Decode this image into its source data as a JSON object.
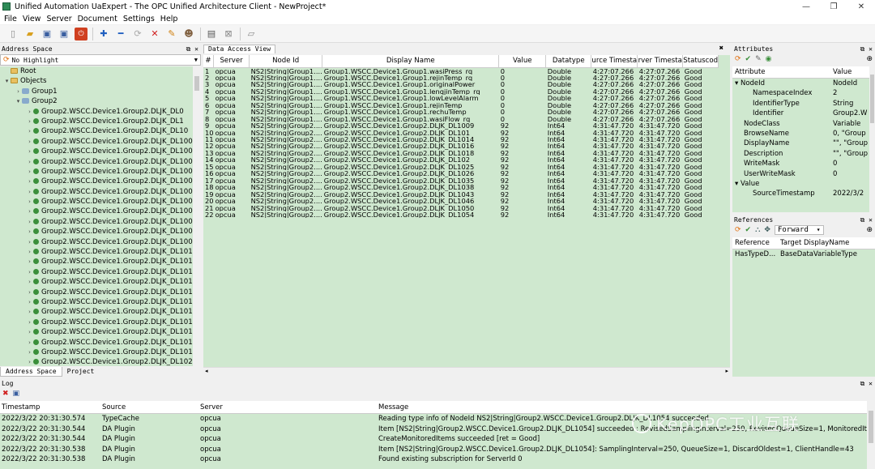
{
  "window": {
    "title": "Unified Automation UaExpert - The OPC Unified Architecture Client - NewProject*",
    "min": "—",
    "max": "❐",
    "close": "✕"
  },
  "menu": [
    "File",
    "View",
    "Server",
    "Document",
    "Settings",
    "Help"
  ],
  "address_space": {
    "title": "Address Space",
    "filter": "No Highlight",
    "tree": [
      {
        "level": 0,
        "exp": "",
        "icon": "folder",
        "label": "Root"
      },
      {
        "level": 0,
        "exp": "▾",
        "icon": "folder",
        "label": "Objects"
      },
      {
        "level": 1,
        "exp": "›",
        "icon": "obj",
        "label": "Group1"
      },
      {
        "level": 1,
        "exp": "▾",
        "icon": "obj",
        "label": "Group2"
      },
      {
        "level": 2,
        "exp": "›",
        "icon": "var",
        "label": "Group2.WSCC.Device1.Group2.DLJK_DL0"
      },
      {
        "level": 2,
        "exp": "›",
        "icon": "var",
        "label": "Group2.WSCC.Device1.Group2.DLJK_DL1"
      },
      {
        "level": 2,
        "exp": "›",
        "icon": "var",
        "label": "Group2.WSCC.Device1.Group2.DLJK_DL10"
      },
      {
        "level": 2,
        "exp": "›",
        "icon": "var",
        "label": "Group2.WSCC.Device1.Group2.DLJK_DL100"
      },
      {
        "level": 2,
        "exp": "›",
        "icon": "var",
        "label": "Group2.WSCC.Device1.Group2.DLJK_DL1000"
      },
      {
        "level": 2,
        "exp": "›",
        "icon": "var",
        "label": "Group2.WSCC.Device1.Group2.DLJK_DL1001"
      },
      {
        "level": 2,
        "exp": "›",
        "icon": "var",
        "label": "Group2.WSCC.Device1.Group2.DLJK_DL1002"
      },
      {
        "level": 2,
        "exp": "›",
        "icon": "var",
        "label": "Group2.WSCC.Device1.Group2.DLJK_DL1003"
      },
      {
        "level": 2,
        "exp": "›",
        "icon": "var",
        "label": "Group2.WSCC.Device1.Group2.DLJK_DL1004"
      },
      {
        "level": 2,
        "exp": "›",
        "icon": "var",
        "label": "Group2.WSCC.Device1.Group2.DLJK_DL1005"
      },
      {
        "level": 2,
        "exp": "›",
        "icon": "var",
        "label": "Group2.WSCC.Device1.Group2.DLJK_DL1006"
      },
      {
        "level": 2,
        "exp": "›",
        "icon": "var",
        "label": "Group2.WSCC.Device1.Group2.DLJK_DL1007"
      },
      {
        "level": 2,
        "exp": "›",
        "icon": "var",
        "label": "Group2.WSCC.Device1.Group2.DLJK_DL1008"
      },
      {
        "level": 2,
        "exp": "›",
        "icon": "var",
        "label": "Group2.WSCC.Device1.Group2.DLJK_DL1009"
      },
      {
        "level": 2,
        "exp": "›",
        "icon": "var",
        "label": "Group2.WSCC.Device1.Group2.DLJK_DL101"
      },
      {
        "level": 2,
        "exp": "›",
        "icon": "var",
        "label": "Group2.WSCC.Device1.Group2.DLJK_DL1010"
      },
      {
        "level": 2,
        "exp": "›",
        "icon": "var",
        "label": "Group2.WSCC.Device1.Group2.DLJK_DL1011"
      },
      {
        "level": 2,
        "exp": "›",
        "icon": "var",
        "label": "Group2.WSCC.Device1.Group2.DLJK_DL1012"
      },
      {
        "level": 2,
        "exp": "›",
        "icon": "var",
        "label": "Group2.WSCC.Device1.Group2.DLJK_DL1013"
      },
      {
        "level": 2,
        "exp": "›",
        "icon": "var",
        "label": "Group2.WSCC.Device1.Group2.DLJK_DL1014"
      },
      {
        "level": 2,
        "exp": "›",
        "icon": "var",
        "label": "Group2.WSCC.Device1.Group2.DLJK_DL1015"
      },
      {
        "level": 2,
        "exp": "›",
        "icon": "var",
        "label": "Group2.WSCC.Device1.Group2.DLJK_DL1016"
      },
      {
        "level": 2,
        "exp": "›",
        "icon": "var",
        "label": "Group2.WSCC.Device1.Group2.DLJK_DL1017"
      },
      {
        "level": 2,
        "exp": "›",
        "icon": "var",
        "label": "Group2.WSCC.Device1.Group2.DLJK_DL1018"
      },
      {
        "level": 2,
        "exp": "›",
        "icon": "var",
        "label": "Group2.WSCC.Device1.Group2.DLJK_DL1019"
      },
      {
        "level": 2,
        "exp": "›",
        "icon": "var",
        "label": "Group2.WSCC.Device1.Group2.DLJK_DL102"
      }
    ],
    "tabs": [
      "Address Space",
      "Project"
    ]
  },
  "data_access_view": {
    "tab": "Data Access View",
    "columns": [
      "#",
      "Server",
      "Node Id",
      "Display Name",
      "Value",
      "Datatype",
      "urce Timesta",
      "rver Timesta",
      "Statuscod"
    ],
    "rows": [
      [
        "1",
        "opcua",
        "NS2|String|Group1....",
        "Group1.WSCC.Device1.Group1.wasiPress_rq",
        "0",
        "Double",
        "4:27:07.266",
        "4:27:07.266",
        "Good"
      ],
      [
        "2",
        "opcua",
        "NS2|String|Group1....",
        "Group1.WSCC.Device1.Group1.rejinTemp_rq",
        "0",
        "Double",
        "4:27:07.266",
        "4:27:07.266",
        "Good"
      ],
      [
        "3",
        "opcua",
        "NS2|String|Group1....",
        "Group1.WSCC.Device1.Group1.originalPower",
        "0",
        "Double",
        "4:27:07.266",
        "4:27:07.266",
        "Good"
      ],
      [
        "4",
        "opcua",
        "NS2|String|Group1....",
        "Group1.WSCC.Device1.Group1.lenqjinTemp_rq",
        "0",
        "Double",
        "4:27:07.266",
        "4:27:07.266",
        "Good"
      ],
      [
        "5",
        "opcua",
        "NS2|String|Group1....",
        "Group1.WSCC.Device1.Group1.lowLevelAlarm",
        "0",
        "Double",
        "4:27:07.266",
        "4:27:07.266",
        "Good"
      ],
      [
        "6",
        "opcua",
        "NS2|String|Group1....",
        "Group1.WSCC.Device1.Group1.rejinTemp",
        "0",
        "Double",
        "4:27:07.266",
        "4:27:07.266",
        "Good"
      ],
      [
        "7",
        "opcua",
        "NS2|String|Group1....",
        "Group1.WSCC.Device1.Group1.rechuTemp",
        "0",
        "Double",
        "4:27:07.266",
        "4:27:07.266",
        "Good"
      ],
      [
        "8",
        "opcua",
        "NS2|String|Group1....",
        "Group1.WSCC.Device1.Group1.wasiFlow_rq",
        "0",
        "Double",
        "4:27:07.266",
        "4:27:07.266",
        "Good"
      ],
      [
        "9",
        "opcua",
        "NS2|String|Group2....",
        "Group2.WSCC.Device1.Group2.DLJK_DL1009",
        "92",
        "Int64",
        "4:31:47.720",
        "4:31:47.720",
        "Good"
      ],
      [
        "10",
        "opcua",
        "NS2|String|Group2....",
        "Group2.WSCC.Device1.Group2.DLJK_DL101",
        "92",
        "Int64",
        "4:31:47.720",
        "4:31:47.720",
        "Good"
      ],
      [
        "11",
        "opcua",
        "NS2|String|Group2....",
        "Group2.WSCC.Device1.Group2.DLJK_DL1014",
        "92",
        "Int64",
        "4:31:47.720",
        "4:31:47.720",
        "Good"
      ],
      [
        "12",
        "opcua",
        "NS2|String|Group2....",
        "Group2.WSCC.Device1.Group2.DLJK_DL1016",
        "92",
        "Int64",
        "4:31:47.720",
        "4:31:47.720",
        "Good"
      ],
      [
        "13",
        "opcua",
        "NS2|String|Group2....",
        "Group2.WSCC.Device1.Group2.DLJK_DL1018",
        "92",
        "Int64",
        "4:31:47.720",
        "4:31:47.720",
        "Good"
      ],
      [
        "14",
        "opcua",
        "NS2|String|Group2....",
        "Group2.WSCC.Device1.Group2.DLJK_DL102",
        "92",
        "Int64",
        "4:31:47.720",
        "4:31:47.720",
        "Good"
      ],
      [
        "15",
        "opcua",
        "NS2|String|Group2....",
        "Group2.WSCC.Device1.Group2.DLJK_DL1025",
        "92",
        "Int64",
        "4:31:47.720",
        "4:31:47.720",
        "Good"
      ],
      [
        "16",
        "opcua",
        "NS2|String|Group2....",
        "Group2.WSCC.Device1.Group2.DLJK_DL1026",
        "92",
        "Int64",
        "4:31:47.720",
        "4:31:47.720",
        "Good"
      ],
      [
        "17",
        "opcua",
        "NS2|String|Group2....",
        "Group2.WSCC.Device1.Group2.DLJK_DL1035",
        "92",
        "Int64",
        "4:31:47.720",
        "4:31:47.720",
        "Good"
      ],
      [
        "18",
        "opcua",
        "NS2|String|Group2....",
        "Group2.WSCC.Device1.Group2.DLJK_DL1038",
        "92",
        "Int64",
        "4:31:47.720",
        "4:31:47.720",
        "Good"
      ],
      [
        "19",
        "opcua",
        "NS2|String|Group2....",
        "Group2.WSCC.Device1.Group2.DLJK_DL1043",
        "92",
        "Int64",
        "4:31:47.720",
        "4:31:47.720",
        "Good"
      ],
      [
        "20",
        "opcua",
        "NS2|String|Group2....",
        "Group2.WSCC.Device1.Group2.DLJK_DL1046",
        "92",
        "Int64",
        "4:31:47.720",
        "4:31:47.720",
        "Good"
      ],
      [
        "21",
        "opcua",
        "NS2|String|Group2....",
        "Group2.WSCC.Device1.Group2.DLJK_DL1050",
        "92",
        "Int64",
        "4:31:47.720",
        "4:31:47.720",
        "Good"
      ],
      [
        "22",
        "opcua",
        "NS2|String|Group2....",
        "Group2.WSCC.Device1.Group2.DLJK_DL1054",
        "92",
        "Int64",
        "4:31:47.720",
        "4:31:47.720",
        "Good"
      ]
    ]
  },
  "attributes": {
    "title": "Attributes",
    "columns": [
      "Attribute",
      "Value"
    ],
    "rows": [
      {
        "indent": 0,
        "exp": "▾",
        "k": "NodeId",
        "v": "NodeId"
      },
      {
        "indent": 2,
        "exp": "",
        "k": "NamespaceIndex",
        "v": "2"
      },
      {
        "indent": 2,
        "exp": "",
        "k": "IdentifierType",
        "v": "String"
      },
      {
        "indent": 2,
        "exp": "",
        "k": "Identifier",
        "v": "Group2.W"
      },
      {
        "indent": 1,
        "exp": "",
        "k": "NodeClass",
        "v": "Variable"
      },
      {
        "indent": 1,
        "exp": "",
        "k": "BrowseName",
        "v": "0, \"Group"
      },
      {
        "indent": 1,
        "exp": "",
        "k": "DisplayName",
        "v": "\"\", \"Group"
      },
      {
        "indent": 1,
        "exp": "",
        "k": "Description",
        "v": "\"\", \"Group"
      },
      {
        "indent": 1,
        "exp": "",
        "k": "WriteMask",
        "v": "0"
      },
      {
        "indent": 1,
        "exp": "",
        "k": "UserWriteMask",
        "v": "0"
      },
      {
        "indent": 0,
        "exp": "▾",
        "k": "Value",
        "v": ""
      },
      {
        "indent": 2,
        "exp": "",
        "k": "SourceTimestamp",
        "v": "2022/3/2"
      }
    ]
  },
  "references": {
    "title": "References",
    "direction": "Forward",
    "columns": [
      "Reference",
      "Target DisplayName"
    ],
    "rows": [
      [
        "HasTypeD...",
        "BaseDataVariableType"
      ]
    ]
  },
  "log": {
    "title": "Log",
    "columns": [
      "Timestamp",
      "Source",
      "Server",
      "Message"
    ],
    "rows": [
      [
        "2022/3/22 20:31:30.574",
        "TypeCache",
        "opcua",
        "Reading type info of NodeId NS2|String|Group2.WSCC.Device1.Group2.DLJK_DL1054 succeeded"
      ],
      [
        "2022/3/22 20:31:30.544",
        "DA Plugin",
        "opcua",
        "Item [NS2|String|Group2.WSCC.Device1.Group2.DLJK_DL1054] succeeded : RevisedSamplingInterval=250, RevisedQueueSize=1, MonitoredItem..."
      ],
      [
        "2022/3/22 20:31:30.544",
        "DA Plugin",
        "opcua",
        "CreateMonitoredItems succeeded [ret = Good]"
      ],
      [
        "2022/3/22 20:31:30.538",
        "DA Plugin",
        "opcua",
        "Item [NS2|String|Group2.WSCC.Device1.Group2.DLJK_DL1054]: SamplingInterval=250, QueueSize=1, DiscardOldest=1, ClientHandle=43"
      ],
      [
        "2022/3/22 20:31:30.538",
        "DA Plugin",
        "opcua",
        "Found existing subscription for ServerId 0"
      ]
    ]
  },
  "watermark": "KepOPC工业互联",
  "colors": {
    "panel_bg": "#cfe8cf",
    "chrome": "#f0f0f0"
  }
}
